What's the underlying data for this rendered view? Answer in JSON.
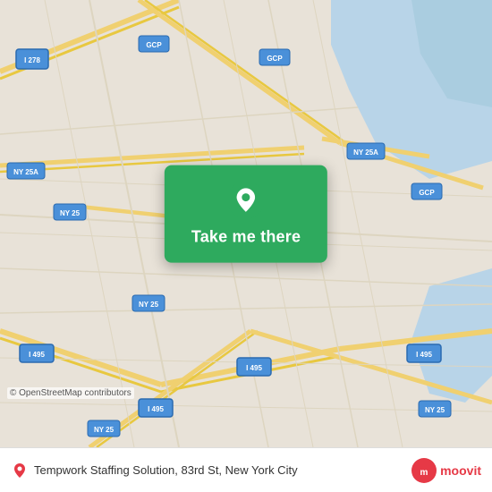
{
  "map": {
    "alt": "Street map of Queens, New York City area",
    "copyright": "© OpenStreetMap contributors"
  },
  "card": {
    "button_label": "Take me there"
  },
  "bottom_bar": {
    "location_text": "Tempwork Staffing Solution, 83rd St, New York City"
  },
  "moovit": {
    "logo_alt": "moovit",
    "label": "moovit"
  }
}
